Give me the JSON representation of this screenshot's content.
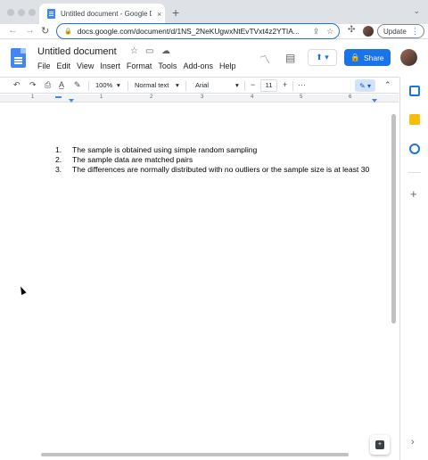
{
  "browser": {
    "tab_title": "Untitled document - Google Do",
    "tab_close": "×",
    "new_tab": "+",
    "tab_menu": "⌄",
    "url": "docs.google.com/document/d/1NS_2NeKUgwxNtEvTVxt4z2YTIA...",
    "update_label": "Update",
    "update_menu": "⋮",
    "accent_color": "#1a73e8"
  },
  "docs": {
    "title": "Untitled document",
    "menus": [
      "File",
      "Edit",
      "View",
      "Insert",
      "Format",
      "Tools",
      "Add-ons",
      "Help"
    ],
    "share_label": "Share"
  },
  "toolbar": {
    "zoom": "100%",
    "style": "Normal text",
    "font": "Arial",
    "font_size": "11",
    "minus": "−",
    "plus": "+",
    "more": "···"
  },
  "ruler": {
    "numbers": [
      "1",
      "1",
      "2",
      "3",
      "4",
      "5",
      "6"
    ]
  },
  "document": {
    "list": [
      {
        "num": "1.",
        "text": "The sample is obtained using simple random sampling"
      },
      {
        "num": "2.",
        "text": "The sample data are matched pairs"
      },
      {
        "num": "3.",
        "text": "The differences are normally distributed with no outliers or the sample size is at least 30"
      }
    ]
  },
  "icons": {
    "back": "arrow-left-icon",
    "forward": "arrow-right-icon",
    "reload": "reload-icon",
    "star": "star-icon",
    "share_page": "share-page-icon",
    "extensions": "puzzle-icon",
    "activity": "trending-icon",
    "comments": "comment-icon",
    "present": "present-icon"
  }
}
